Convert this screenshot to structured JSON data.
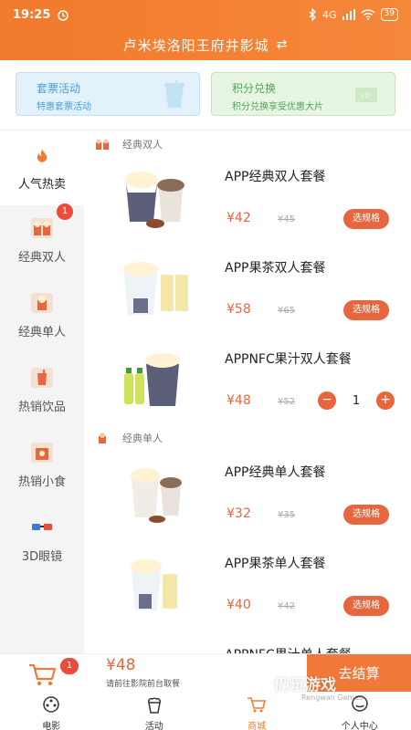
{
  "status_bar": {
    "time": "19:25",
    "network": "4G",
    "battery": "39"
  },
  "header": {
    "cinema_name": "卢米埃洛阳王府井影城"
  },
  "promos": [
    {
      "title": "套票活动",
      "subtitle": "特惠套票活动",
      "icon": "ticket-cup-icon"
    },
    {
      "title": "积分兑换",
      "subtitle": "积分兑换享受优惠大片",
      "icon": "vip-card-icon"
    }
  ],
  "sidebar": {
    "items": [
      {
        "label": "人气热卖",
        "icon": "flame-icon",
        "active": true
      },
      {
        "label": "经典双人",
        "icon": "popcorn-double-icon",
        "badge": "1"
      },
      {
        "label": "经典单人",
        "icon": "popcorn-single-icon"
      },
      {
        "label": "热销饮品",
        "icon": "drink-icon"
      },
      {
        "label": "热销小食",
        "icon": "snack-icon"
      },
      {
        "label": "3D眼镜",
        "icon": "3d-glasses-icon"
      }
    ]
  },
  "sections": [
    {
      "title": "经典双人",
      "products": [
        {
          "name": "APP经典双人套餐",
          "price": "¥42",
          "original": "¥45",
          "action": "选规格"
        },
        {
          "name": "APP果茶双人套餐",
          "price": "¥58",
          "original": "¥65",
          "action": "选规格"
        },
        {
          "name": "APPNFC果汁双人套餐",
          "price": "¥48",
          "original": "¥52",
          "quantity": "1"
        }
      ]
    },
    {
      "title": "经典单人",
      "products": [
        {
          "name": "APP经典单人套餐",
          "price": "¥32",
          "original": "¥35",
          "action": "选规格"
        },
        {
          "name": "APP果茶单人套餐",
          "price": "¥40",
          "original": "¥42",
          "action": "选规格"
        },
        {
          "name": "APPNFC果汁单人套餐",
          "price": "",
          "original": "",
          "action": ""
        }
      ]
    }
  ],
  "cart": {
    "badge": "1",
    "total": "¥48",
    "note": "请前往影院前台取餐",
    "checkout_label": "去结算"
  },
  "tabbar": {
    "items": [
      {
        "label": "电影",
        "icon": "film-reel-icon"
      },
      {
        "label": "活动",
        "icon": "popcorn-tab-icon"
      },
      {
        "label": "商城",
        "icon": "cart-tab-icon",
        "active": true
      },
      {
        "label": "个人中心",
        "icon": "user-icon"
      }
    ]
  },
  "watermark": {
    "text": "仍玩游戏",
    "sub": "Rengwan Games"
  },
  "colors": {
    "accent": "#f0793a",
    "price": "#e8663d",
    "badge": "#e74c3c"
  }
}
